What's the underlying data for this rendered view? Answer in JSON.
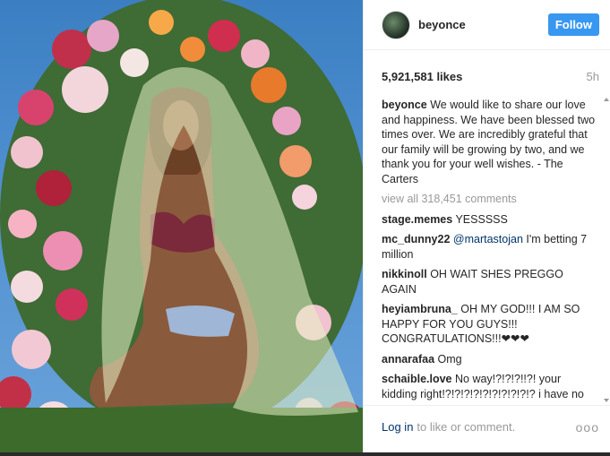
{
  "post": {
    "photo": {
      "description_icon": "photo-image",
      "sky_color": "#4a8acb"
    },
    "header": {
      "username": "beyonce",
      "follow_label": "Follow"
    },
    "stats": {
      "likes": "5,921,581 likes",
      "time": "5h"
    },
    "caption": {
      "username": "beyonce",
      "text": "We would like to share our love and happiness. We have been blessed two times over. We are incredibly grateful that our family will be growing by two, and we thank you for your well wishes. - The Carters"
    },
    "view_all": "view all 318,451 comments",
    "comments": [
      {
        "user": "stage.memes",
        "mention": "",
        "text": "YESSSSS"
      },
      {
        "user": "mc_dunny22",
        "mention": "@martastojan",
        "text": "I'm betting 7 million"
      },
      {
        "user": "nikkinoll",
        "mention": "",
        "text": "OH WAIT SHES PREGGO AGAIN"
      },
      {
        "user": "heyiambruna_",
        "mention": "",
        "text": "OH MY GOD!!! I AM SO HAPPY FOR YOU GUYS!!! CONGRATULATIONS!!!❤❤❤"
      },
      {
        "user": "annarafaa",
        "mention": "",
        "text": "Omg"
      },
      {
        "user": "schaible.love",
        "mention": "",
        "text": "No way!?!?!?!!?! your kidding right!?!?!?!?!?!?!?!?!?!? i have no emotions right now, you are so blessed, omg this is incredible. best wishes for"
      }
    ],
    "footer": {
      "login_label": "Log in",
      "suffix": "to like or comment.",
      "more_label": "ooo"
    }
  },
  "colors": {
    "accent": "#3897f0",
    "link": "#003569",
    "muted": "#999999"
  }
}
